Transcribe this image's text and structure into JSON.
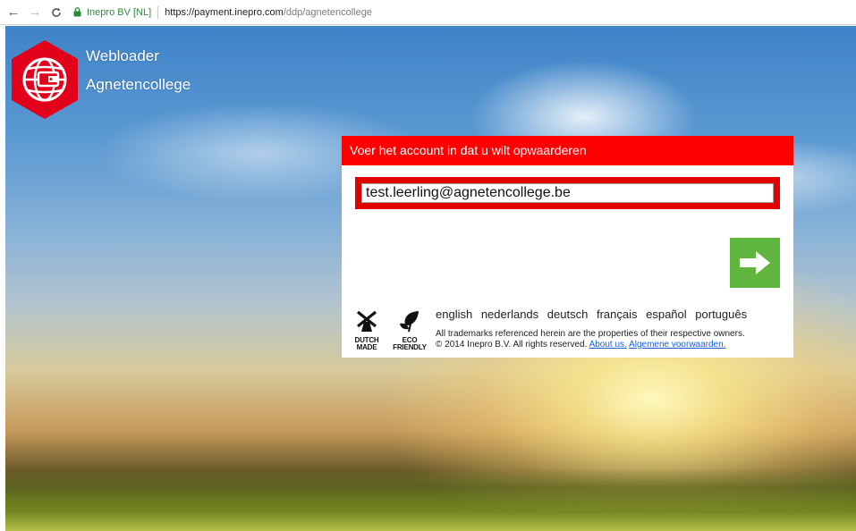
{
  "browser": {
    "back_icon": "arrow-left-icon",
    "forward_icon": "arrow-right-icon",
    "reload_icon": "reload-icon",
    "lock_icon": "lock-icon",
    "site_identity": "Inepro BV [NL]",
    "url_host": "https://payment.inepro.com",
    "url_path": "/ddp/agnetencollege"
  },
  "brand": {
    "logo_icon": "globe-wallet-icon",
    "title": "Webloader",
    "subtitle": "Agnetencollege",
    "color": "#e3001b"
  },
  "form": {
    "header": "Voer het account in dat u wilt opwaarderen",
    "account_value": "test.leerling@agnetencollege.be",
    "submit_icon": "arrow-right-icon",
    "header_color": "#ff0000",
    "submit_color": "#5fb53e"
  },
  "footer": {
    "badges": [
      {
        "icon": "windmill-icon",
        "line1": "DUTCH",
        "line2": "MADE"
      },
      {
        "icon": "leaf-icon",
        "line1": "ECO",
        "line2": "FRIENDLY"
      }
    ],
    "languages": [
      "english",
      "nederlands",
      "deutsch",
      "français",
      "español",
      "português"
    ],
    "trademark": "All trademarks referenced herein are the properties of their respective owners.",
    "copyright": "© 2014 Inepro B.V. All rights reserved.",
    "about_link": "About us.",
    "terms_link": "Algemene voorwaarden."
  }
}
